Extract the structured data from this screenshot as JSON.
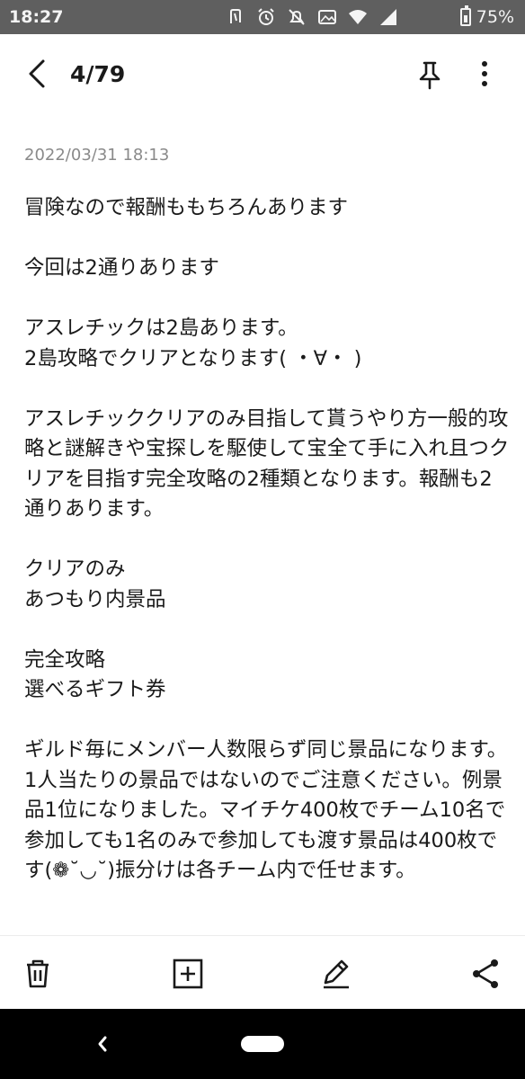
{
  "status_bar": {
    "time": "18:27",
    "battery_percent": "75%",
    "icons": [
      "nfc-icon",
      "alarm-icon",
      "bell-off-icon",
      "photo-icon",
      "wifi-icon",
      "signal-icon"
    ]
  },
  "header": {
    "page_count": "4/79",
    "icons": [
      "back-arrow-icon",
      "pin-icon",
      "more-vertical-icon"
    ]
  },
  "note": {
    "timestamp": "2022/03/31 18:13",
    "body": "冒険なので報酬ももちろんあります\n\n今回は2通りあります\n\nアスレチックは2島あります。\n2島攻略でクリアとなります( ・∀・ )\n\nアスレチッククリアのみ目指して貰うやり方一般的攻略と謎解きや宝探しを駆使して宝全て手に入れ且つクリアを目指す完全攻略の2種類となります。報酬も2通りあります。\n\nクリアのみ\nあつもり内景品\n\n完全攻略\n選べるギフト券\n\nギルド毎にメンバー人数限らず同じ景品になります。1人当たりの景品ではないのでご注意ください。例景品1位になりました。マイチケ400枚でチーム10名で参加しても1名のみで参加しても渡す景品は400枚です(❁˘◡˘)振分けは各チーム内で任せます。"
  },
  "toolbar": {
    "icons": [
      "trash-icon",
      "add-box-icon",
      "edit-icon",
      "share-icon"
    ]
  },
  "nav_bar": {
    "icons": [
      "nav-back-icon",
      "home-pill-icon"
    ]
  }
}
